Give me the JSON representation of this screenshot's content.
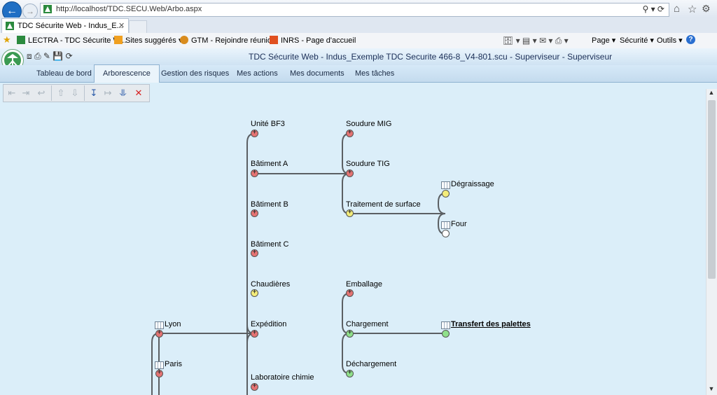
{
  "browser": {
    "url": "http://localhost/TDC.SECU.Web/Arbo.aspx",
    "tab_title": "TDC Sécurite Web - Indus_E...",
    "favorites": [
      {
        "label": "LECTRA - TDC Sécurite W..."
      },
      {
        "label": "Sites suggérés ▾"
      },
      {
        "label": "GTM - Rejoindre réunion"
      },
      {
        "label": "INRS - Page d'accueil"
      }
    ],
    "command_bar": [
      "Page ▾",
      "Sécurité ▾",
      "Outils ▾"
    ]
  },
  "app": {
    "title": "TDC Sécurite Web - Indus_Exemple TDC Securite 466-8_V4-801.scu - Superviseur - Superviseur",
    "menu": [
      "Tableau de bord",
      "Arborescence",
      "Gestion des risques",
      "Mes actions",
      "Mes documents",
      "Mes tâches"
    ],
    "active_menu": "Arborescence"
  },
  "tree": {
    "nodes": [
      {
        "id": "lyon",
        "label": "Lyon",
        "status": "red",
        "grid_icon": true
      },
      {
        "id": "paris",
        "label": "Paris",
        "status": "red",
        "grid_icon": true
      },
      {
        "id": "unite-bf3",
        "label": "Unité BF3",
        "status": "red"
      },
      {
        "id": "batiment-a",
        "label": "Bâtiment A",
        "status": "red"
      },
      {
        "id": "batiment-b",
        "label": "Bâtiment B",
        "status": "red"
      },
      {
        "id": "batiment-c",
        "label": "Bâtiment C",
        "status": "red"
      },
      {
        "id": "chaudieres",
        "label": "Chaudières",
        "status": "yellow"
      },
      {
        "id": "expedition",
        "label": "Expédition",
        "status": "red"
      },
      {
        "id": "laboratoire",
        "label": "Laboratoire chimie",
        "status": "red"
      },
      {
        "id": "soudure-mig",
        "label": "Soudure MIG",
        "status": "red"
      },
      {
        "id": "soudure-tig",
        "label": "Soudure TIG",
        "status": "red"
      },
      {
        "id": "traitement",
        "label": "Traitement de surface",
        "status": "yellow"
      },
      {
        "id": "emballage",
        "label": "Emballage",
        "status": "red"
      },
      {
        "id": "chargement",
        "label": "Chargement",
        "status": "green"
      },
      {
        "id": "dechargement",
        "label": "Déchargement",
        "status": "green"
      },
      {
        "id": "degraissage",
        "label": "Dégraissage",
        "status": "yellow-plain",
        "grid_icon": true
      },
      {
        "id": "four",
        "label": "Four",
        "status": "white-plain",
        "grid_icon": true
      },
      {
        "id": "transfert",
        "label": "Transfert des palettes",
        "status": "green-plain",
        "grid_icon": true,
        "link": true
      }
    ]
  },
  "colors": {
    "red": "#e57373",
    "yellow": "#f3ec7a",
    "green": "#8fe08a",
    "white": "#ffffff"
  }
}
